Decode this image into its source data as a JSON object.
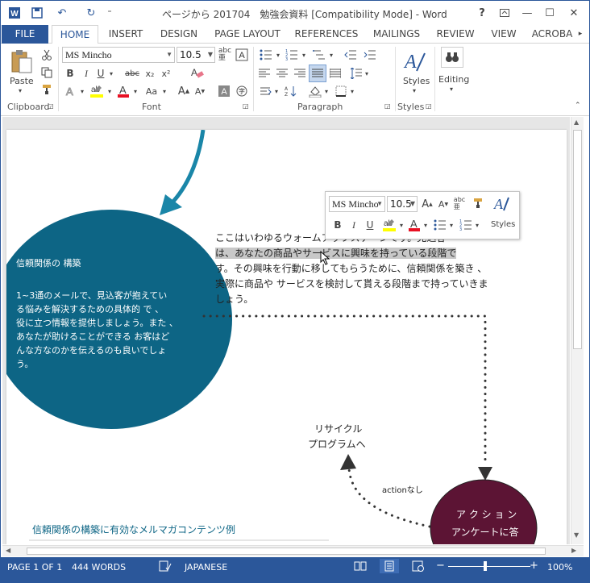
{
  "window": {
    "title": "ページから 201704　勉強会資料 [Compatibility Mode] - Word",
    "help": "?",
    "minimize": "—",
    "maximize": "☐",
    "close": "✕"
  },
  "qat": {
    "undo": "↶",
    "redo": "↻",
    "more": "⁼"
  },
  "tabs": [
    {
      "label": "FILE"
    },
    {
      "label": "HOME"
    },
    {
      "label": "INSERT"
    },
    {
      "label": "DESIGN"
    },
    {
      "label": "PAGE LAYOUT"
    },
    {
      "label": "REFERENCES"
    },
    {
      "label": "MAILINGS"
    },
    {
      "label": "REVIEW"
    },
    {
      "label": "VIEW"
    },
    {
      "label": "ACROBA"
    }
  ],
  "ribbon": {
    "paste_label": "Paste",
    "font_name": "MS Mincho",
    "font_size": "10.5",
    "styles_label": "Styles",
    "editing_label": "Editing",
    "groups": {
      "clipboard": "Clipboard",
      "font": "Font",
      "paragraph": "Paragraph",
      "styles": "Styles"
    },
    "btn": {
      "bold": "B",
      "italic": "I",
      "underline": "U",
      "strike": "abc",
      "sub": "x₂",
      "sup": "x²",
      "grow": "A^",
      "shrink": "Aˇ",
      "case": "Aa",
      "abc": "abc",
      "clear": "A"
    }
  },
  "mini_toolbar": {
    "font_name": "MS Mincho",
    "font_size": "10.5",
    "styles_label": "Styles",
    "bold": "B",
    "italic": "I",
    "underline": "U"
  },
  "document": {
    "circle_title": "信頼関係の 構築",
    "circle_lines": [
      "1~3通のメールで、見込客が抱えてい",
      "る悩みを解決するための具体的 で 、",
      "役に立つ情報を提供しましょう。また 、",
      "あなたが助けることができる お客はど",
      "んな方なのかを伝えるのも良いでしょ",
      "う。"
    ],
    "body_lines": [
      "ここはいわゆるウォームアップステージです。見込客",
      "は、あなたの商品やサービスに興味を持っている段階で",
      "す。その興味を行動に移してもらうために、信頼関係を築き 、",
      "実際に商品や サービスを検討して貰える段階まで持っていきま",
      "しょう。"
    ],
    "recycle_line1": "リサイクル",
    "recycle_line2": "プログラムへ",
    "action_none": "actionなし",
    "action_circle_line1": "ア ク シ ョ ン",
    "action_circle_line2": "アンケートに答",
    "bottom_heading": "信頼関係の構築に有効なメルマガコンテンツ例"
  },
  "status": {
    "page": "PAGE 1 OF 1",
    "words": "444 WORDS",
    "language": "JAPANESE",
    "zoom": "100%",
    "zoom_minus": "−",
    "zoom_plus": "+"
  },
  "colors": {
    "brand": "#2b579a",
    "circle_teal": "#0d6585",
    "circle_maroon": "#5c1434",
    "arrow_teal": "#1a86a8"
  }
}
